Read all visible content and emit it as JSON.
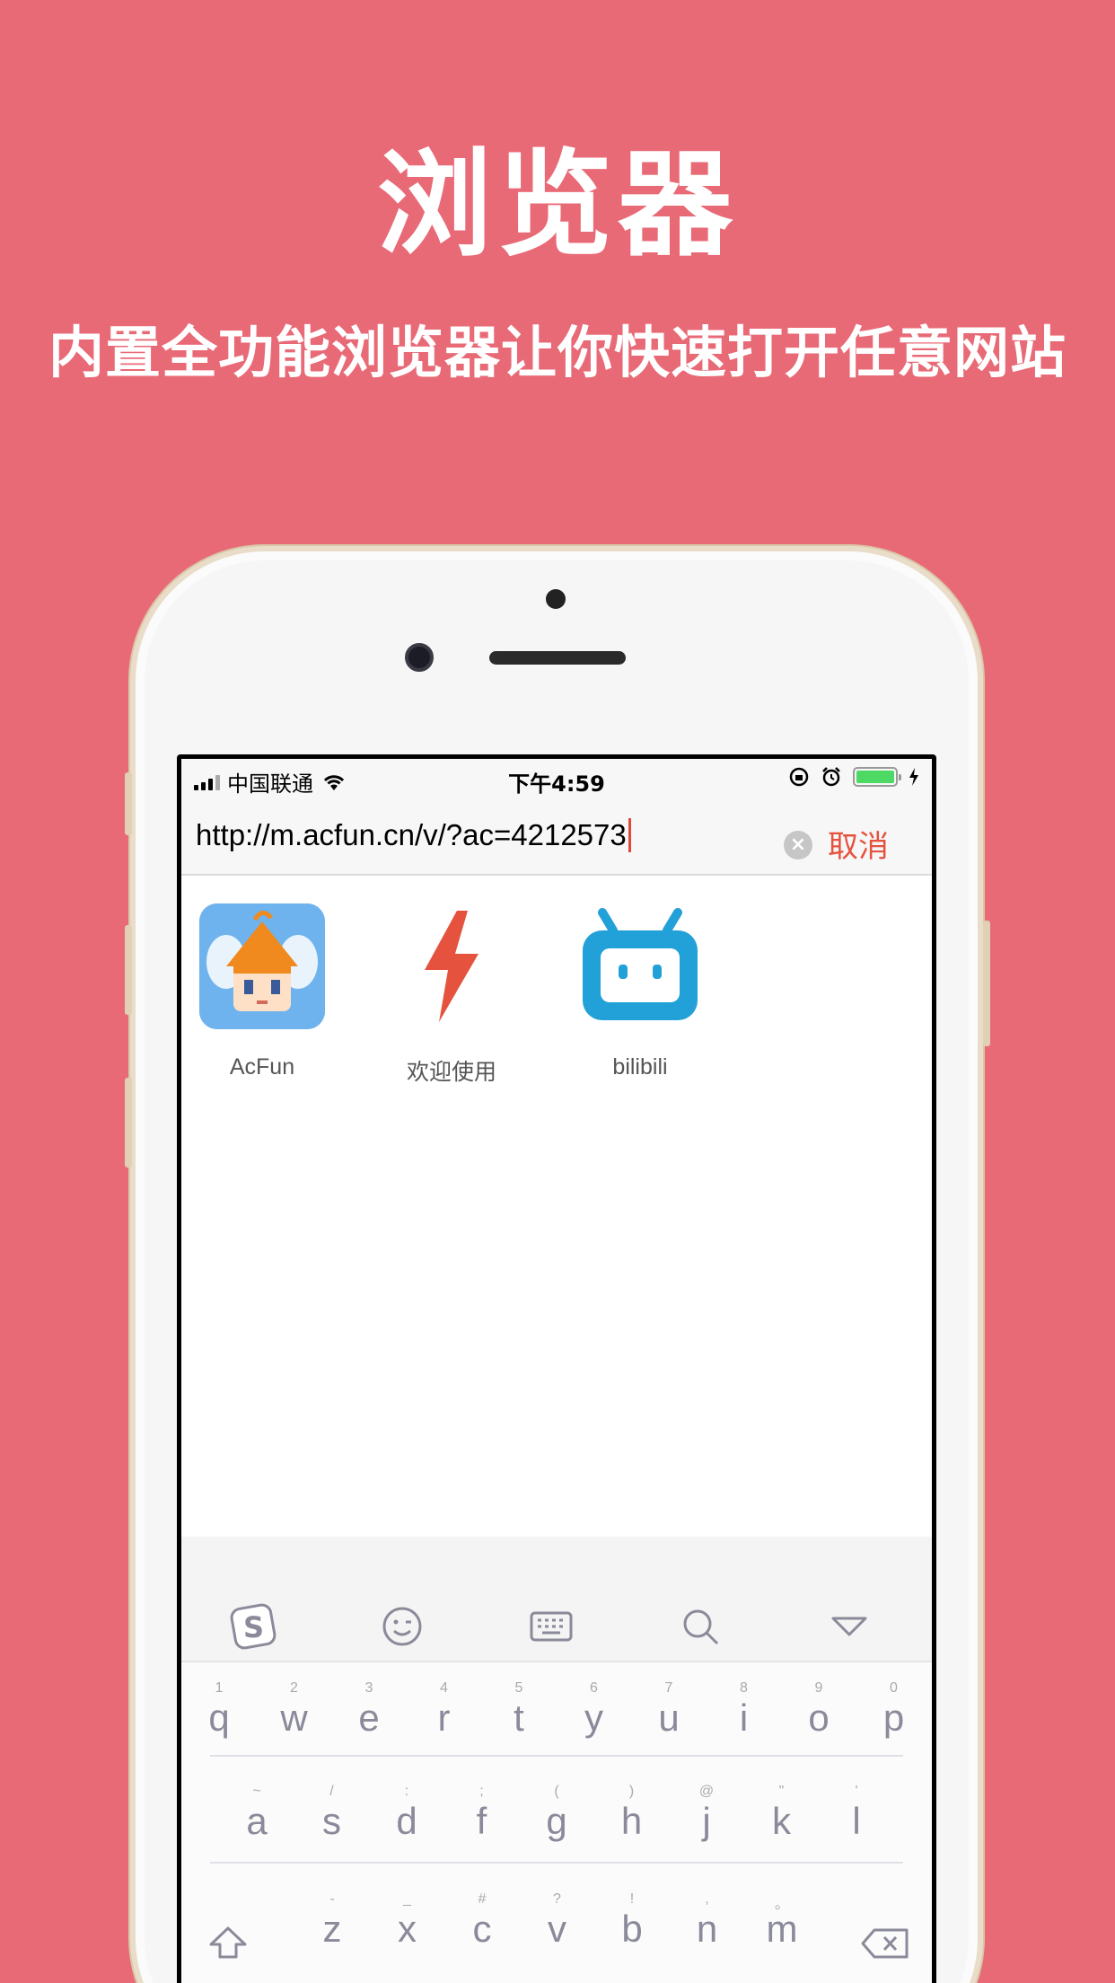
{
  "promo": {
    "title": "浏览器",
    "subtitle": "内置全功能浏览器让你快速打开任意网站"
  },
  "status_bar": {
    "carrier": "中国联通",
    "time": "下午4:59",
    "battery_level": 1.0
  },
  "url_bar": {
    "value": "http://m.acfun.cn/v/?ac=4212573",
    "clear_icon": "×",
    "cancel_label": "取消"
  },
  "shortcuts": [
    {
      "label": "AcFun",
      "icon": "acfun-icon"
    },
    {
      "label": "欢迎使用",
      "icon": "lightning-icon"
    },
    {
      "label": "bilibili",
      "icon": "bilibili-icon"
    }
  ],
  "keyboard_toolbar": [
    "sogou-logo-icon",
    "emoji-icon",
    "keyboard-icon",
    "search-icon",
    "collapse-icon"
  ],
  "keyboard": {
    "row1": [
      {
        "hint": "1",
        "ch": "q"
      },
      {
        "hint": "2",
        "ch": "w"
      },
      {
        "hint": "3",
        "ch": "e"
      },
      {
        "hint": "4",
        "ch": "r"
      },
      {
        "hint": "5",
        "ch": "t"
      },
      {
        "hint": "6",
        "ch": "y"
      },
      {
        "hint": "7",
        "ch": "u"
      },
      {
        "hint": "8",
        "ch": "i"
      },
      {
        "hint": "9",
        "ch": "o"
      },
      {
        "hint": "0",
        "ch": "p"
      }
    ],
    "row2": [
      {
        "hint": "~",
        "ch": "a"
      },
      {
        "hint": "/",
        "ch": "s"
      },
      {
        "hint": ":",
        "ch": "d"
      },
      {
        "hint": ";",
        "ch": "f"
      },
      {
        "hint": "(",
        "ch": "g"
      },
      {
        "hint": ")",
        "ch": "h"
      },
      {
        "hint": "@",
        "ch": "j"
      },
      {
        "hint": "\"",
        "ch": "k"
      },
      {
        "hint": "'",
        "ch": "l"
      }
    ],
    "row3": [
      {
        "hint": "-",
        "ch": "z"
      },
      {
        "hint": "_",
        "ch": "x"
      },
      {
        "hint": "#",
        "ch": "c"
      },
      {
        "hint": "?",
        "ch": "v"
      },
      {
        "hint": "!",
        "ch": "b"
      },
      {
        "hint": ",",
        "ch": "n"
      },
      {
        "hint": "。",
        "ch": "m"
      }
    ]
  },
  "colors": {
    "background": "#e96a77",
    "accent": "#e5533f",
    "bilibili": "#22a1d8",
    "acfun_bg": "#5aa6e8"
  }
}
